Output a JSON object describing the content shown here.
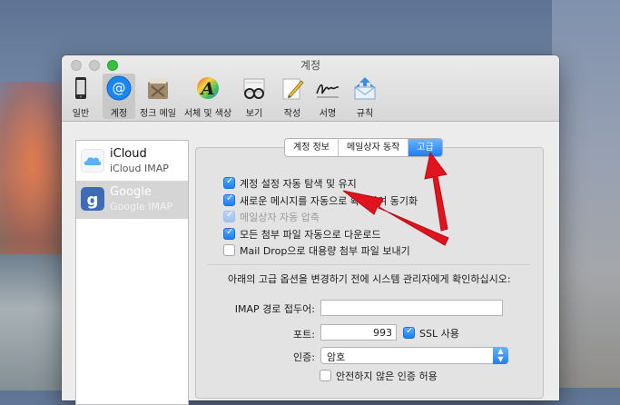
{
  "window": {
    "title": "계정"
  },
  "toolbar": {
    "items": [
      {
        "label": "일반",
        "icon": "iphone-general-icon"
      },
      {
        "label": "계정",
        "icon": "at-sign-accounts-icon"
      },
      {
        "label": "정크 메일",
        "icon": "junk-mail-trash-icon"
      },
      {
        "label": "서체 및 색상",
        "icon": "fonts-colors-icon"
      },
      {
        "label": "보기",
        "icon": "glasses-viewing-icon"
      },
      {
        "label": "작성",
        "icon": "pencil-compose-icon"
      },
      {
        "label": "서명",
        "icon": "signature-icon"
      },
      {
        "label": "규칙",
        "icon": "rules-envelope-icon"
      }
    ],
    "active": "계정"
  },
  "accounts": [
    {
      "name": "iCloud",
      "type": "iCloud IMAP",
      "icon": "icloud-icon"
    },
    {
      "name": "Google",
      "type": "Google IMAP",
      "icon": "google-icon"
    }
  ],
  "tabs": {
    "items": [
      "계정 정보",
      "메일상자 동작",
      "고급"
    ],
    "active": "고급"
  },
  "advanced": {
    "options": [
      {
        "label": "계정 설정 자동 탐색 및 유지",
        "checked": true,
        "disabled": false
      },
      {
        "label": "새로운 메시지를 자동으로 확인하여 동기화",
        "checked": true,
        "disabled": false
      },
      {
        "label": "메일상자 자동 압축",
        "checked": true,
        "disabled": true
      },
      {
        "label": "모든 첨부 파일 자동으로 다운로드",
        "checked": true,
        "disabled": false
      },
      {
        "label": "Mail Drop으로 대용량 첨부 파일 보내기",
        "checked": false,
        "disabled": false
      }
    ],
    "note": "아래의 고급 옵션을 변경하기 전에 시스템 관리자에게 확인하십시오:",
    "imap_prefix_label": "IMAP 경로 접두어:",
    "imap_prefix_value": "",
    "port_label": "포트:",
    "port_value": "993",
    "ssl_label": "SSL 사용",
    "ssl_checked": true,
    "auth_label": "인증:",
    "auth_value": "암호",
    "insecure_label": "안전하지 않은 인증 허용",
    "insecure_checked": false
  },
  "colors": {
    "accent": "#1e7ef5",
    "annotation_arrow": "#e0141e"
  }
}
